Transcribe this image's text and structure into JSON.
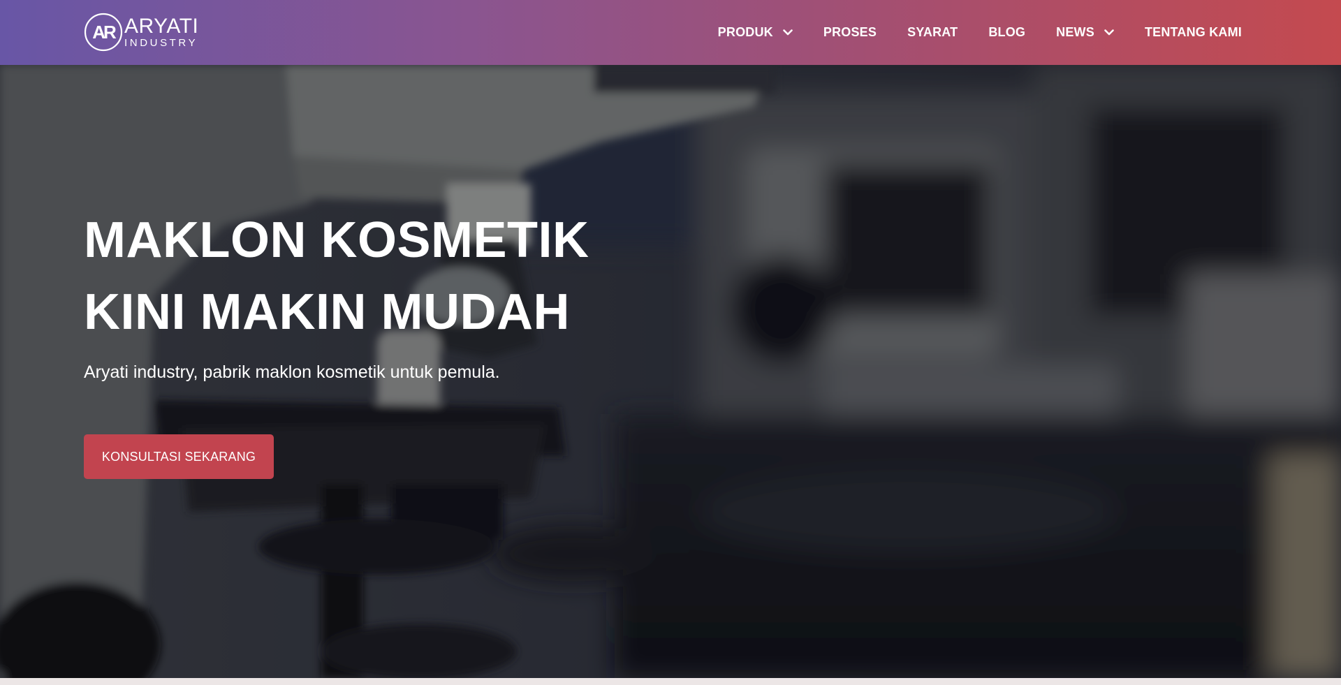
{
  "brand": {
    "name": "ARYATI",
    "tagline": "INDUSTRY",
    "mark": "AR"
  },
  "nav": {
    "items": [
      {
        "label": "PRODUK",
        "has_dropdown": true
      },
      {
        "label": "PROSES",
        "has_dropdown": false
      },
      {
        "label": "SYARAT",
        "has_dropdown": false
      },
      {
        "label": "BLOG",
        "has_dropdown": false
      },
      {
        "label": "NEWS",
        "has_dropdown": true
      },
      {
        "label": "TENTANG KAMI",
        "has_dropdown": false
      }
    ]
  },
  "hero": {
    "title_line1": "MAKLON KOSMETIK",
    "title_line2": "KINI MAKIN MUDAH",
    "subtitle": "Aryati industry, pabrik maklon kosmetik untuk pemula.",
    "cta_label": "KONSULTASI SEKARANG"
  },
  "colors": {
    "header_gradient_start": "#6856a6",
    "header_gradient_end": "#c44a4f",
    "cta_background": "#c2444f",
    "text": "#ffffff"
  },
  "icons": {
    "logo": "ar-monogram-circle-icon",
    "dropdown": "chevron-down-icon"
  }
}
